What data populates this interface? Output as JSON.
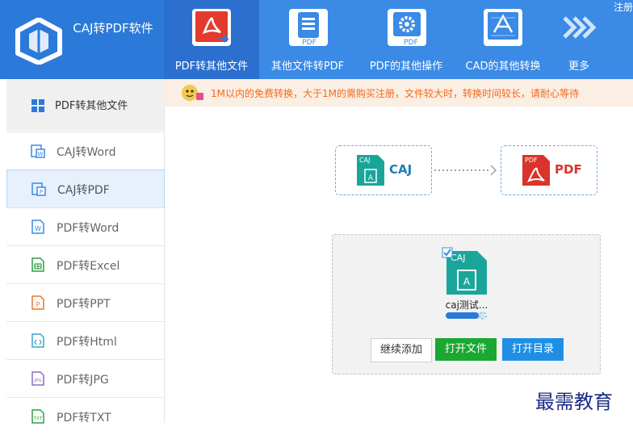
{
  "app": {
    "title": "CAJ转PDF软件"
  },
  "corner_text": "注册",
  "toolbar": {
    "items": [
      {
        "label": "PDF转其他文件",
        "icon": "pdf-icon",
        "badge": "",
        "active": true
      },
      {
        "label": "其他文件转PDF",
        "icon": "document-to-pdf-icon",
        "badge": "PDF",
        "active": false
      },
      {
        "label": "PDF的其他操作",
        "icon": "gear-pdf-icon",
        "badge": "PDF",
        "active": false
      },
      {
        "label": "CAD的其他转换",
        "icon": "cad-icon",
        "badge": "",
        "active": false
      },
      {
        "label": "更多",
        "icon": "chevrons-right-icon",
        "badge": "",
        "active": false
      }
    ]
  },
  "sidebar": {
    "header": "PDF转其他文件",
    "items": [
      {
        "label": "CAJ转Word",
        "icon": "caj-word-icon",
        "selected": false
      },
      {
        "label": "CAJ转PDF",
        "icon": "caj-pdf-icon",
        "selected": true
      },
      {
        "label": "PDF转Word",
        "icon": "word-icon",
        "selected": false
      },
      {
        "label": "PDF转Excel",
        "icon": "excel-icon",
        "selected": false
      },
      {
        "label": "PDF转PPT",
        "icon": "ppt-icon",
        "selected": false
      },
      {
        "label": "PDF转Html",
        "icon": "html-icon",
        "selected": false
      },
      {
        "label": "PDF转JPG",
        "icon": "jpg-icon",
        "selected": false
      },
      {
        "label": "PDF转TXT",
        "icon": "txt-icon",
        "selected": false
      }
    ]
  },
  "notice": "1M以内的免费转换，大于1M的需购买注册，文件较大时，转换时间较长，请耐心等待",
  "conversion": {
    "from": {
      "label": "CAJ",
      "tag": "CAJ"
    },
    "to": {
      "label": "PDF",
      "tag": "PDF"
    }
  },
  "file": {
    "name": "caj测试...",
    "progress": 0.85,
    "tag": "CAJ"
  },
  "buttons": {
    "add_more": "继续添加",
    "open_file": "打开文件",
    "open_dir": "打开目录"
  },
  "watermark": "最需教育",
  "colors": {
    "header_blue": "#3a8ae6",
    "logo_blue": "#2b7ad9",
    "notice_orange": "#f26b1d",
    "caj_teal": "#1aa59a",
    "pdf_red": "#d9342b",
    "green_button": "#1aa832",
    "blue_button": "#1f8fe6"
  }
}
